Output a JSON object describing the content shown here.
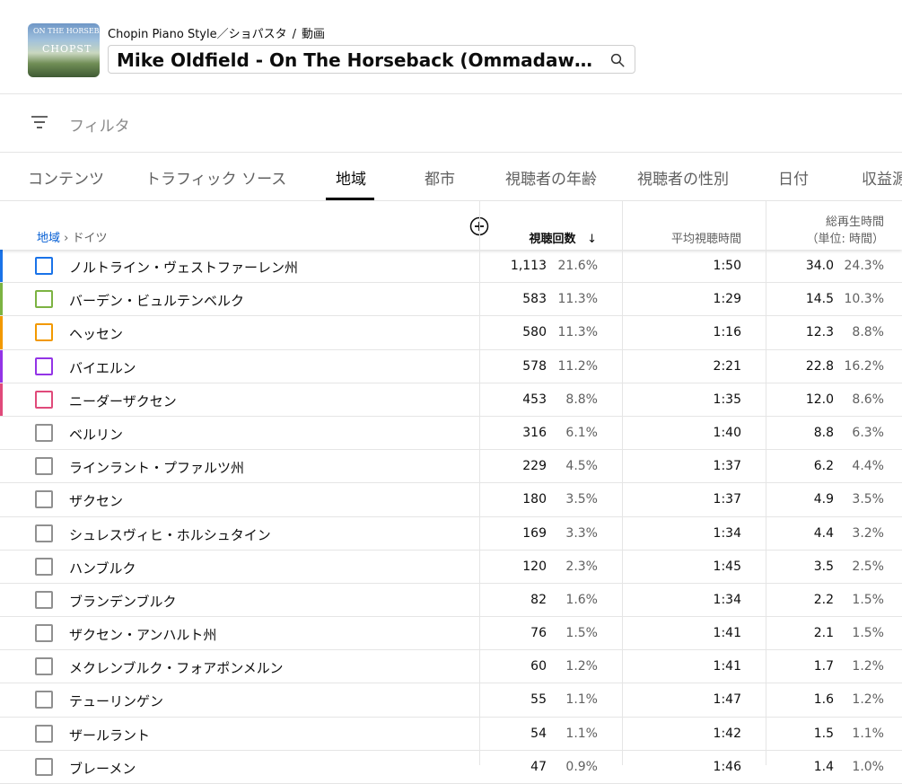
{
  "header": {
    "channel": "Chopin Piano Style／ショパスタ",
    "section": "動画",
    "video_title": "Mike Oldfield - On The Horseback (Ommadawn Reimagined) | Piano Cover",
    "thumbnail_text_top": "ON THE HORSEBACK",
    "thumbnail_text_main": "CHOPST"
  },
  "filter": {
    "label": "フィルタ"
  },
  "tabs": [
    "コンテンツ",
    "トラフィック ソース",
    "地域",
    "都市",
    "視聴者の年齢",
    "視聴者の性別",
    "日付",
    "収益源"
  ],
  "active_tab": 2,
  "table": {
    "breadcrumb_link": "地域",
    "breadcrumb_current": "ドイツ",
    "col_views": "視聴回数",
    "col_avg": "平均視聴時間",
    "col_watch_line1": "総再生時間",
    "col_watch_line2": "（単位: 時間）",
    "sort_indicator": "↓",
    "rows": [
      {
        "name": "ノルトライン・ヴェストファーレン州",
        "views": "1,113",
        "views_pct": "21.6%",
        "avg": "1:50",
        "watch": "34.0",
        "watch_pct": "24.3%",
        "color": "#1a73e8"
      },
      {
        "name": "バーデン・ビュルテンベルク",
        "views": "583",
        "views_pct": "11.3%",
        "avg": "1:29",
        "watch": "14.5",
        "watch_pct": "10.3%",
        "color": "#7cb342"
      },
      {
        "name": "ヘッセン",
        "views": "580",
        "views_pct": "11.3%",
        "avg": "1:16",
        "watch": "12.3",
        "watch_pct": "8.8%",
        "color": "#f29900"
      },
      {
        "name": "バイエルン",
        "views": "578",
        "views_pct": "11.2%",
        "avg": "2:21",
        "watch": "22.8",
        "watch_pct": "16.2%",
        "color": "#9334e6"
      },
      {
        "name": "ニーダーザクセン",
        "views": "453",
        "views_pct": "8.8%",
        "avg": "1:35",
        "watch": "12.0",
        "watch_pct": "8.6%",
        "color": "#e04a7a"
      },
      {
        "name": "ベルリン",
        "views": "316",
        "views_pct": "6.1%",
        "avg": "1:40",
        "watch": "8.8",
        "watch_pct": "6.3%",
        "color": ""
      },
      {
        "name": "ラインラント・プファルツ州",
        "views": "229",
        "views_pct": "4.5%",
        "avg": "1:37",
        "watch": "6.2",
        "watch_pct": "4.4%",
        "color": ""
      },
      {
        "name": "ザクセン",
        "views": "180",
        "views_pct": "3.5%",
        "avg": "1:37",
        "watch": "4.9",
        "watch_pct": "3.5%",
        "color": ""
      },
      {
        "name": "シュレスヴィヒ・ホルシュタイン",
        "views": "169",
        "views_pct": "3.3%",
        "avg": "1:34",
        "watch": "4.4",
        "watch_pct": "3.2%",
        "color": ""
      },
      {
        "name": "ハンブルク",
        "views": "120",
        "views_pct": "2.3%",
        "avg": "1:45",
        "watch": "3.5",
        "watch_pct": "2.5%",
        "color": ""
      },
      {
        "name": "ブランデンブルク",
        "views": "82",
        "views_pct": "1.6%",
        "avg": "1:34",
        "watch": "2.2",
        "watch_pct": "1.5%",
        "color": ""
      },
      {
        "name": "ザクセン・アンハルト州",
        "views": "76",
        "views_pct": "1.5%",
        "avg": "1:41",
        "watch": "2.1",
        "watch_pct": "1.5%",
        "color": ""
      },
      {
        "name": "メクレンブルク・フォアポンメルン",
        "views": "60",
        "views_pct": "1.2%",
        "avg": "1:41",
        "watch": "1.7",
        "watch_pct": "1.2%",
        "color": ""
      },
      {
        "name": "テューリンゲン",
        "views": "55",
        "views_pct": "1.1%",
        "avg": "1:47",
        "watch": "1.6",
        "watch_pct": "1.2%",
        "color": ""
      },
      {
        "name": "ザールラント",
        "views": "54",
        "views_pct": "1.1%",
        "avg": "1:42",
        "watch": "1.5",
        "watch_pct": "1.1%",
        "color": ""
      },
      {
        "name": "ブレーメン",
        "views": "47",
        "views_pct": "0.9%",
        "avg": "1:46",
        "watch": "1.4",
        "watch_pct": "1.0%",
        "color": ""
      }
    ]
  }
}
